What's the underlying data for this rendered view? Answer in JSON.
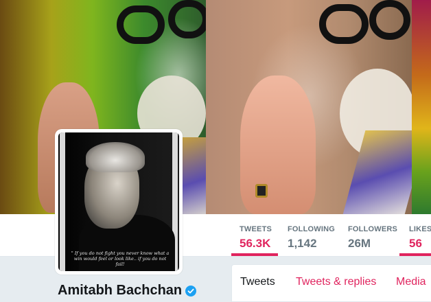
{
  "profile": {
    "name": "Amitabh Bachchan",
    "avatar_quote": "\" If you do not fight you never know what a win would feel or look like.. if you do not fail!"
  },
  "stats": [
    {
      "label": "TWEETS",
      "value": "56.3K",
      "active": true
    },
    {
      "label": "FOLLOWING",
      "value": "1,142",
      "active": false
    },
    {
      "label": "FOLLOWERS",
      "value": "26M",
      "active": false
    },
    {
      "label": "LIKES",
      "value": "56",
      "active": false
    }
  ],
  "tabs": [
    {
      "label": "Tweets",
      "selected": true
    },
    {
      "label": "Tweets & replies",
      "selected": false
    },
    {
      "label": "Media",
      "selected": false
    }
  ],
  "colors": {
    "accent": "#e0245e",
    "verified": "#1da1f2",
    "background": "#e6ecf0",
    "muted_text": "#66757f"
  },
  "icons": {
    "verified": "verified-badge-icon"
  }
}
